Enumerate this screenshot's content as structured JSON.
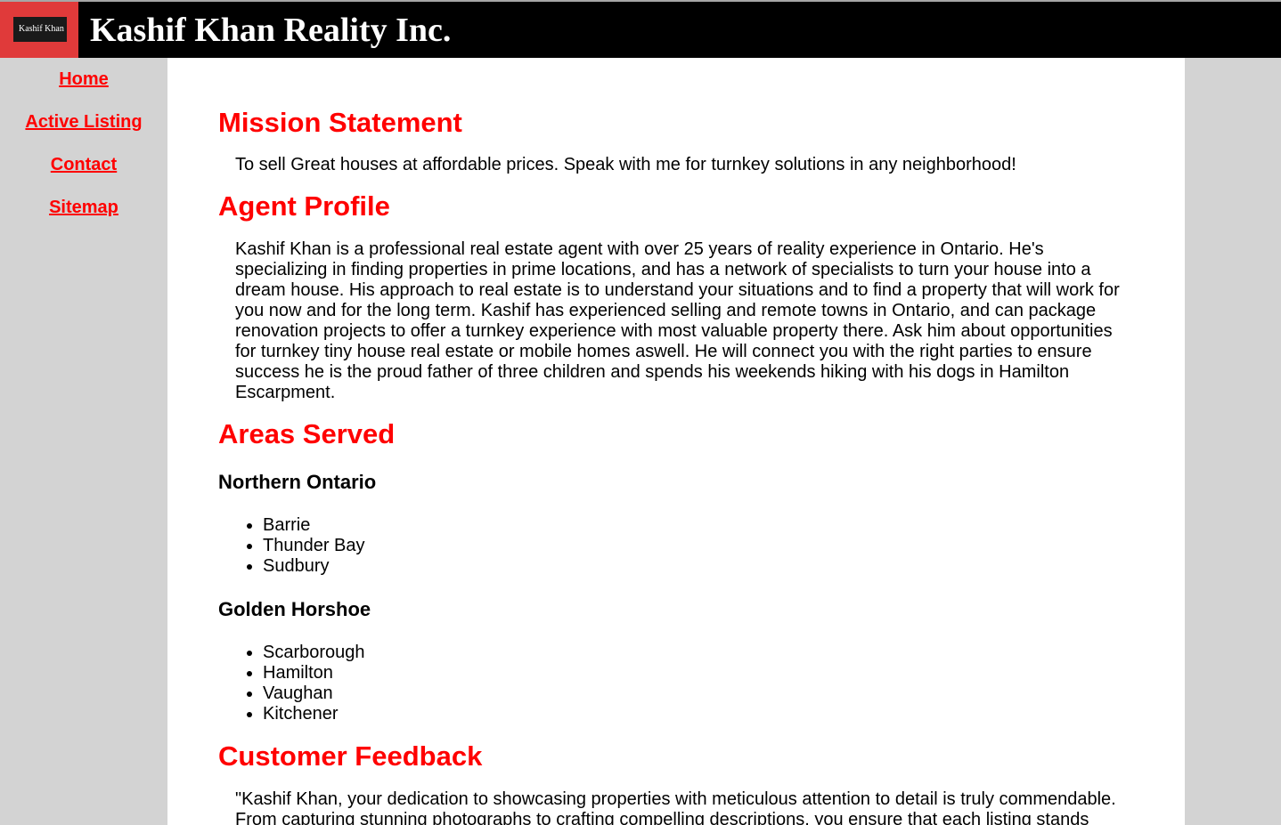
{
  "header": {
    "logo_text": "Kashif Khan",
    "site_title": "Kashif Khan Reality Inc."
  },
  "nav": {
    "items": [
      {
        "label": "Home"
      },
      {
        "label": "Active Listing"
      },
      {
        "label": "Contact"
      },
      {
        "label": "Sitemap"
      }
    ]
  },
  "mission": {
    "heading": "Mission Statement",
    "text": "To sell Great houses at affordable prices. Speak with me for turnkey solutions in any neighborhood!"
  },
  "profile": {
    "heading": "Agent Profile",
    "text": "Kashif Khan is a professional real estate agent with over 25 years of reality experience in Ontario. He's specializing in finding properties in prime locations, and has a network of specialists to turn your house into a dream house. His approach to real estate is to understand your situations and to find a property that will work for you now and for the long term. Kashif has experienced selling and remote towns in Ontario, and can package renovation projects to offer a turnkey experience with most valuable property there. Ask him about opportunities for turnkey tiny house real estate or mobile homes aswell. He will connect you with the right parties to ensure success he is the proud father of three children and spends his weekends hiking with his dogs in Hamilton Escarpment."
  },
  "areas": {
    "heading": "Areas Served",
    "regions": [
      {
        "name": "Northern Ontario",
        "cities": [
          "Barrie",
          "Thunder Bay",
          "Sudbury"
        ]
      },
      {
        "name": "Golden Horshoe",
        "cities": [
          "Scarborough",
          "Hamilton",
          "Vaughan",
          "Kitchener"
        ]
      }
    ]
  },
  "feedback": {
    "heading": "Customer Feedback",
    "text": "\"Kashif Khan, your dedication to showcasing properties with meticulous attention to detail is truly commendable. From capturing stunning photographs to crafting compelling descriptions, you ensure that each listing stands"
  },
  "colors": {
    "header_bg": "#000000",
    "accent_red": "#ff0000",
    "sidebar_bg": "#d3d3d3",
    "content_bg": "#ffffff",
    "logo_bg": "#e03a3a"
  }
}
